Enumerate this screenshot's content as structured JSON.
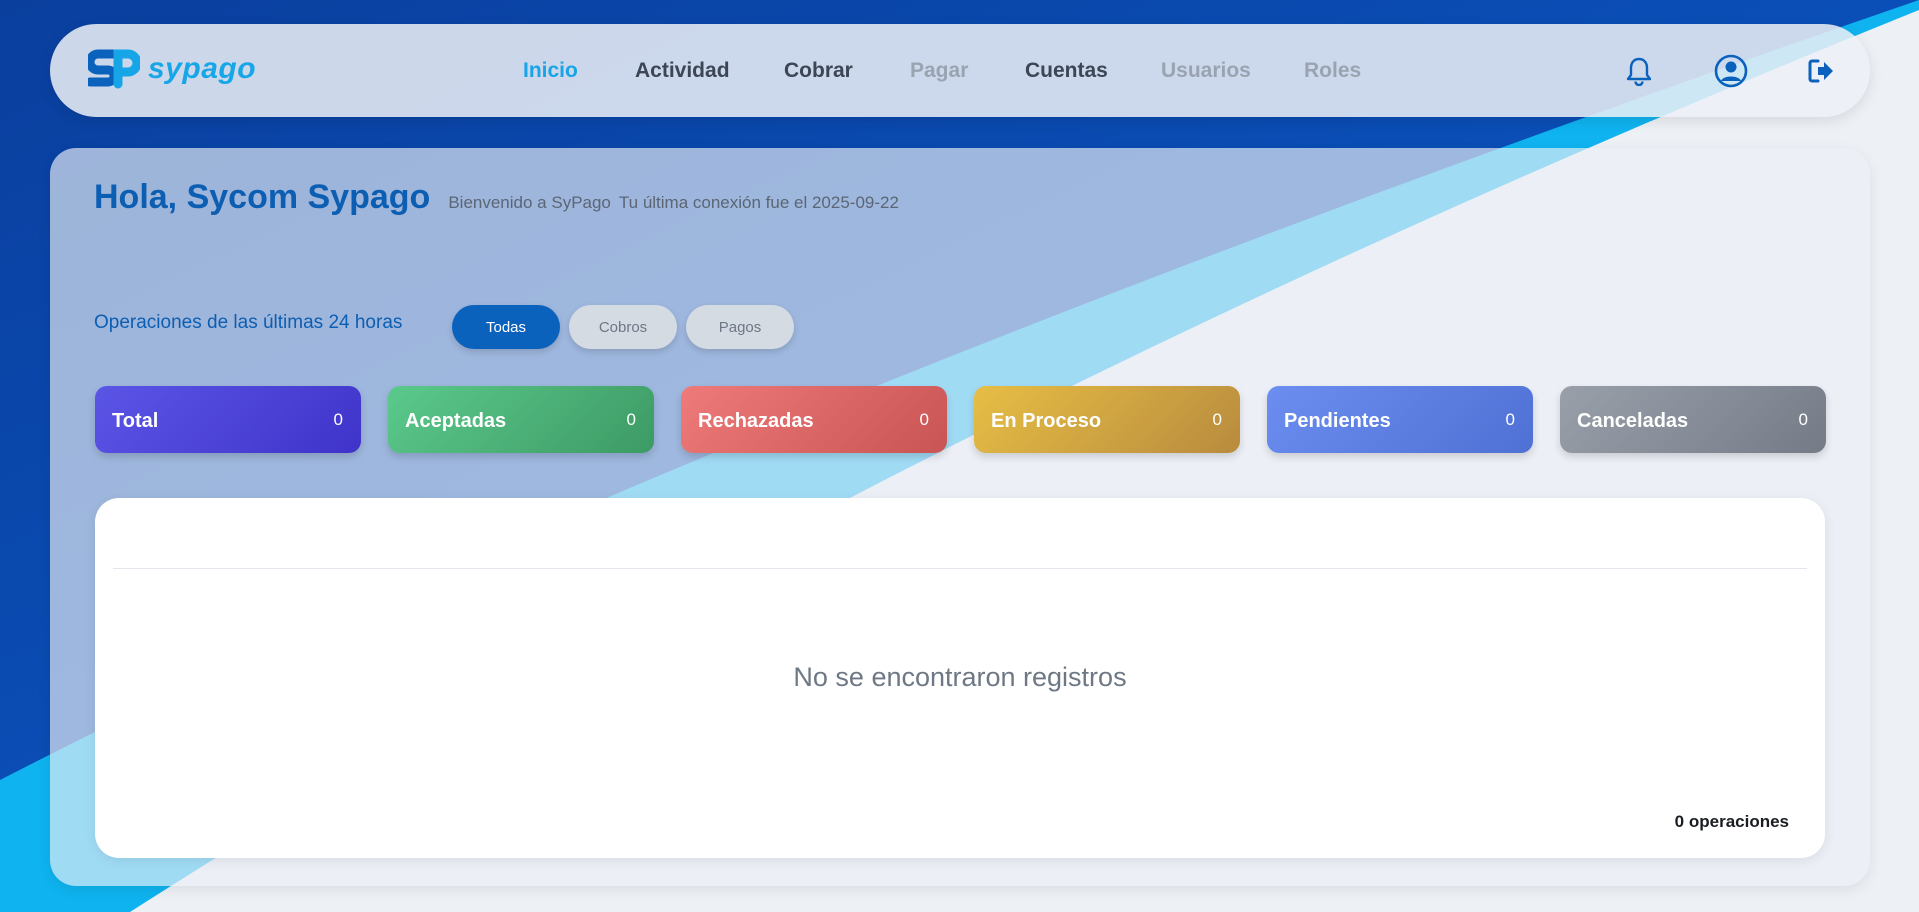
{
  "brand": {
    "name": "sypago",
    "color": "#17a6e8"
  },
  "nav": {
    "links": [
      {
        "label": "Inicio",
        "state": "active"
      },
      {
        "label": "Actividad",
        "state": "normal"
      },
      {
        "label": "Cobrar",
        "state": "normal"
      },
      {
        "label": "Pagar",
        "state": "disabled"
      },
      {
        "label": "Cuentas",
        "state": "normal"
      },
      {
        "label": "Usuarios",
        "state": "disabled"
      },
      {
        "label": "Roles",
        "state": "disabled"
      }
    ],
    "icons": [
      "bell-icon",
      "user-circle-icon",
      "logout-icon"
    ]
  },
  "greeting": {
    "title": "Hola, Sycom Sypago",
    "subtitle": "Bienvenido a SyPago",
    "last_connection": "Tu última conexión fue el 2025-09-22"
  },
  "operations": {
    "label": "Operaciones de las últimas 24 horas",
    "filters": [
      {
        "label": "Todas",
        "active": true
      },
      {
        "label": "Cobros",
        "active": false
      },
      {
        "label": "Pagos",
        "active": false
      }
    ]
  },
  "stats": [
    {
      "label": "Total",
      "value": "0",
      "color_from": "#5b55e6",
      "color_to": "#3f33c9"
    },
    {
      "label": "Aceptadas",
      "value": "0",
      "color_from": "#5bc98c",
      "color_to": "#3d9a64"
    },
    {
      "label": "Rechazadas",
      "value": "0",
      "color_from": "#ef7a7a",
      "color_to": "#c95454"
    },
    {
      "label": "En Proceso",
      "value": "0",
      "color_from": "#e7be45",
      "color_to": "#b88b3e"
    },
    {
      "label": "Pendientes",
      "value": "0",
      "color_from": "#6b8ef0",
      "color_to": "#4f70d4"
    },
    {
      "label": "Canceladas",
      "value": "0",
      "color_from": "#9aa0aa",
      "color_to": "#747b87"
    }
  ],
  "table": {
    "empty_message": "No se encontraron registros",
    "count_label": "0 operaciones"
  }
}
